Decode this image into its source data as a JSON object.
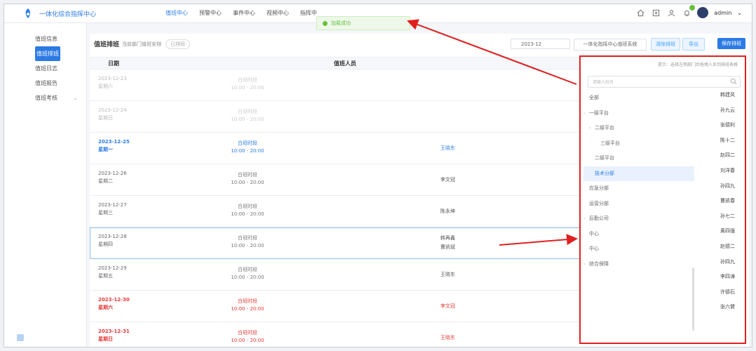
{
  "header": {
    "app_title": "一体化综合指挥中心",
    "nav": [
      "值班中心",
      "预警中心",
      "事件中心",
      "视频中心",
      "指挥中"
    ],
    "active_nav": 0,
    "toast": "加载成功",
    "username": "admin"
  },
  "sidebar": {
    "items": [
      {
        "label": "值班信息",
        "active": false,
        "expandable": false
      },
      {
        "label": "值班排班",
        "active": true,
        "expandable": false
      },
      {
        "label": "值班日志",
        "active": false,
        "expandable": false
      },
      {
        "label": "值班报告",
        "active": false,
        "expandable": false
      },
      {
        "label": "值班考核",
        "active": false,
        "expandable": true
      }
    ]
  },
  "toolbar": {
    "title": "值班排班",
    "subtitle": "当前部门值班安排",
    "pill": "已排班",
    "date_value": "2023-12",
    "org_select": "一体化指挥中心值班系统",
    "btn_clear": "清除排班",
    "btn_export": "导出",
    "btn_save": "保存排班"
  },
  "table": {
    "col_date": "日期",
    "col_staff": "值班人员",
    "rows": [
      {
        "date": "2023-12-23",
        "weekday": "星期六",
        "shift": "白班时段",
        "time": "10:00 - 20:00",
        "staff": [],
        "style": "faded"
      },
      {
        "date": "2023-12-24",
        "weekday": "星期日",
        "shift": "白班时段",
        "time": "10:00 - 20:00",
        "staff": [],
        "style": "faded"
      },
      {
        "date": "2023-12-25",
        "weekday": "星期一",
        "shift": "白班时段",
        "time": "10:00 - 20:00",
        "staff": [
          "王晓东"
        ],
        "style": "blue"
      },
      {
        "date": "2023-12-26",
        "weekday": "星期二",
        "shift": "白班时段",
        "time": "10:00 - 20:00",
        "staff": [
          "李文冠"
        ],
        "style": "normal"
      },
      {
        "date": "2023-12-27",
        "weekday": "星期三",
        "shift": "白班时段",
        "time": "10:00 - 20:00",
        "staff": [
          "陈永坤"
        ],
        "style": "normal"
      },
      {
        "date": "2023-12-28",
        "weekday": "星期四",
        "shift": "白班时段",
        "time": "10:00 - 20:00",
        "staff": [
          "韩再鑫",
          "曹凯斌"
        ],
        "style": "selected"
      },
      {
        "date": "2023-12-29",
        "weekday": "星期五",
        "shift": "白班时段",
        "time": "10:00 - 20:00",
        "staff": [
          "王晓东"
        ],
        "style": "normal"
      },
      {
        "date": "2023-12-30",
        "weekday": "星期六",
        "shift": "白班时段",
        "time": "10:00 - 20:00",
        "staff": [
          "李文冠"
        ],
        "style": "red"
      },
      {
        "date": "2023-12-31",
        "weekday": "星期日",
        "shift": "白班时段",
        "time": "10:00 - 20:00",
        "staff": [
          "王晓东"
        ],
        "style": "red"
      }
    ]
  },
  "panel": {
    "tip": "提示：选择左侧部门后拖拽人员到排班表格",
    "search_placeholder": "请输入姓名",
    "tree": [
      {
        "label": "全部",
        "level": 0,
        "caret": false,
        "active": false
      },
      {
        "label": "一级平台",
        "level": 0,
        "caret": true,
        "active": false
      },
      {
        "label": "二级平台",
        "level": 1,
        "caret": true,
        "active": false
      },
      {
        "label": "三级平台",
        "level": 2,
        "caret": false,
        "active": false
      },
      {
        "label": "二级平台",
        "level": 1,
        "caret": false,
        "active": false
      },
      {
        "label": "技术分部",
        "level": 1,
        "caret": false,
        "active": true
      },
      {
        "label": "应急分部",
        "level": 0,
        "caret": false,
        "active": false
      },
      {
        "label": "运营分部",
        "level": 0,
        "caret": false,
        "active": false
      },
      {
        "label": "后勤公司",
        "level": 0,
        "caret": true,
        "active": false
      },
      {
        "label": "中心",
        "level": 0,
        "caret": false,
        "active": false
      },
      {
        "label": "中心",
        "level": 0,
        "caret": false,
        "active": false
      },
      {
        "label": "综合保障",
        "level": 0,
        "caret": true,
        "active": false
      }
    ],
    "staff": [
      "韩建风",
      "孙九云",
      "张德利",
      "陈十二",
      "赵四二",
      "刘洋春",
      "孙四九",
      "曹凯春",
      "孙七二",
      "黄四强",
      "赵德二",
      "孙四九",
      "李四涛",
      "许德石",
      "张六健"
    ]
  },
  "colors": {
    "accent": "#2c7be5",
    "annotation": "#e02020",
    "weekend": "#e53935",
    "success": "#67c23a"
  }
}
